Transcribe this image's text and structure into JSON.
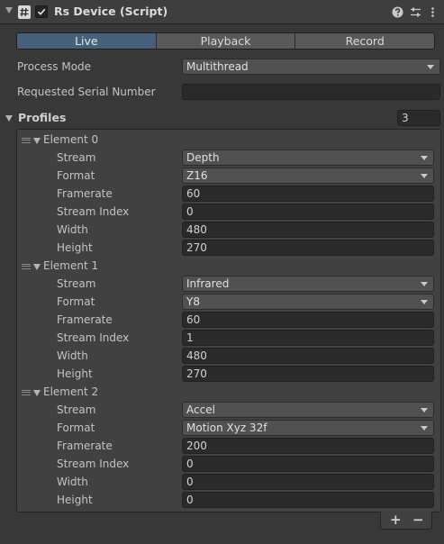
{
  "component": {
    "title": "Rs Device (Script)"
  },
  "tabs": [
    {
      "label": "Live",
      "active": true
    },
    {
      "label": "Playback",
      "active": false
    },
    {
      "label": "Record",
      "active": false
    }
  ],
  "fields": {
    "process_mode_label": "Process Mode",
    "process_mode_value": "Multithread",
    "serial_label": "Requested Serial Number",
    "serial_value": ""
  },
  "profiles": {
    "label": "Profiles",
    "size": "3",
    "field_labels": {
      "stream": "Stream",
      "format": "Format",
      "framerate": "Framerate",
      "stream_index": "Stream Index",
      "width": "Width",
      "height": "Height"
    },
    "elements": [
      {
        "label": "Element 0",
        "stream": "Depth",
        "format": "Z16",
        "framerate": "60",
        "stream_index": "0",
        "width": "480",
        "height": "270"
      },
      {
        "label": "Element 1",
        "stream": "Infrared",
        "format": "Y8",
        "framerate": "60",
        "stream_index": "1",
        "width": "480",
        "height": "270"
      },
      {
        "label": "Element 2",
        "stream": "Accel",
        "format": "Motion Xyz 32f",
        "framerate": "200",
        "stream_index": "0",
        "width": "0",
        "height": "0"
      }
    ]
  },
  "footer": {
    "add_label": "+",
    "remove_label": "−"
  },
  "colors": {
    "background": "#383838",
    "active_tab": "#46607c",
    "field": "#2a2a2a",
    "dropdown": "#515151"
  }
}
